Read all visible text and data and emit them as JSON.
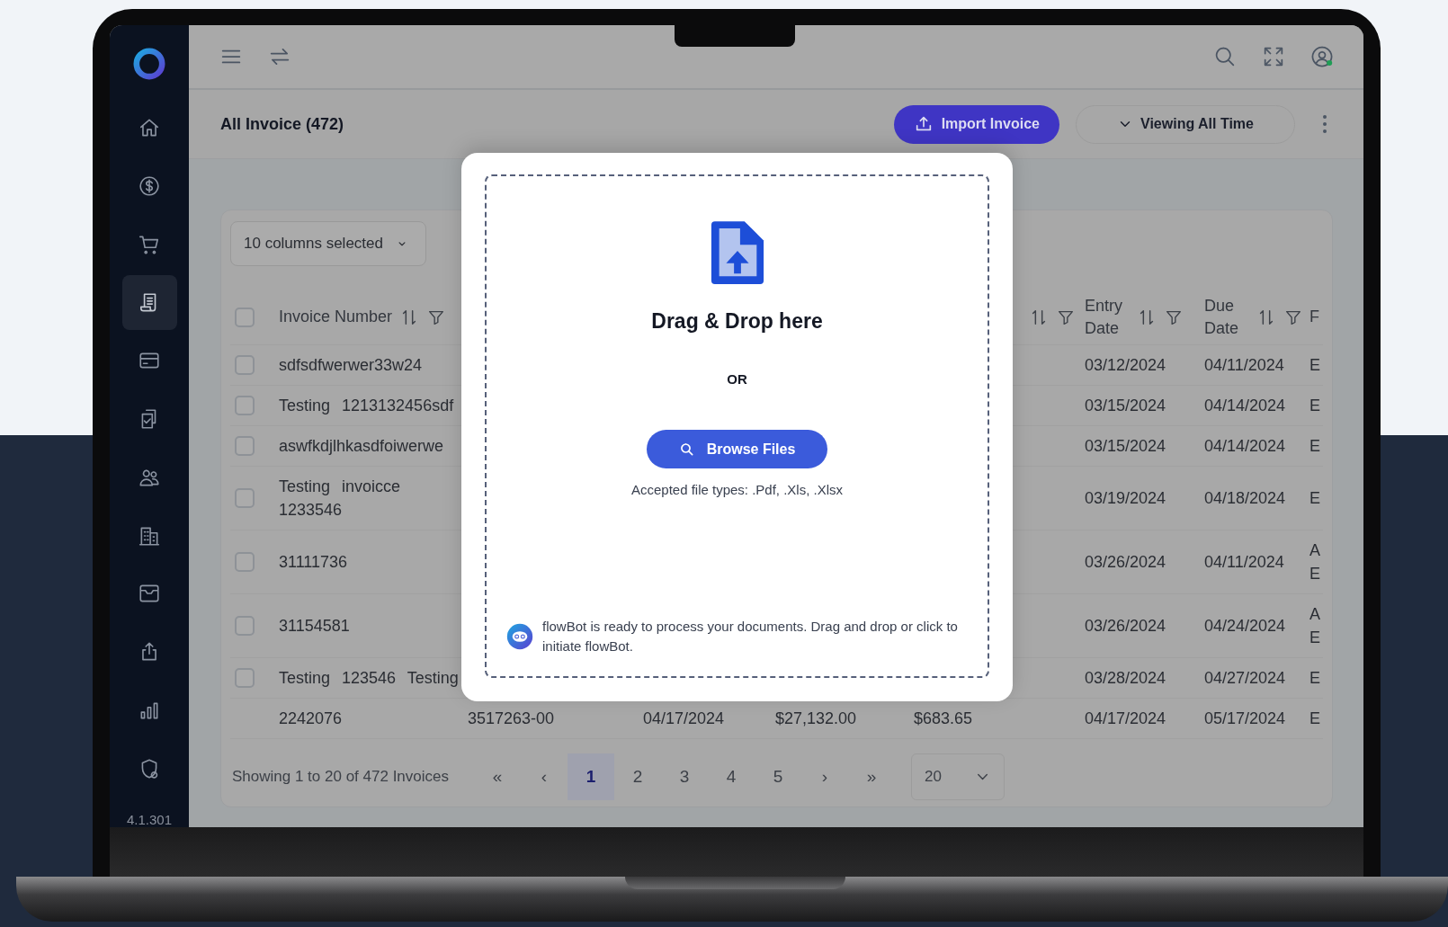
{
  "sidebar": {
    "items": [
      {
        "selected": false
      },
      {
        "selected": false
      },
      {
        "selected": false
      },
      {
        "selected": true
      },
      {
        "selected": false
      },
      {
        "selected": false
      },
      {
        "selected": false
      },
      {
        "selected": false
      },
      {
        "selected": false
      },
      {
        "selected": false
      },
      {
        "selected": false
      }
    ],
    "version": "4.1.301"
  },
  "header": {
    "title": "All Invoice (472)",
    "import_button": "Import Invoice",
    "period_button": "Viewing All Time"
  },
  "table": {
    "columns_selector": "10 columns selected",
    "select_all_checked": false,
    "columns": {
      "invoice_number": "Invoice Number",
      "entry_date": "Entry Date",
      "due_date": "Due Date",
      "column_8": "F"
    },
    "rows": [
      {
        "kind": "item",
        "checked": false,
        "invoice_number": "sdfsdfwerwer33w24",
        "entry_date": "03/12/2024",
        "due_date": "04/11/2024",
        "column_8": "E"
      },
      {
        "kind": "item",
        "checked": false,
        "invoice_number": "Testing 1213132456sdf",
        "entry_date": "03/15/2024",
        "due_date": "04/14/2024",
        "column_8": "E"
      },
      {
        "kind": "item",
        "checked": false,
        "invoice_number": "aswfkdjlhkasdfoiwerwe",
        "entry_date": "03/15/2024",
        "due_date": "04/14/2024",
        "column_8": "E"
      },
      {
        "kind": "item",
        "checked": false,
        "invoice_number": "Testing invoicce 1233546",
        "entry_date": "03/19/2024",
        "due_date": "04/18/2024",
        "column_8": "E"
      },
      {
        "kind": "item",
        "checked": false,
        "invoice_number": "31111736",
        "entry_date": "03/26/2024",
        "due_date": "04/11/2024",
        "column_8": "A E"
      },
      {
        "kind": "item",
        "checked": false,
        "invoice_number": "31154581",
        "entry_date": "03/26/2024",
        "due_date": "04/24/2024",
        "column_8": "A E"
      },
      {
        "kind": "item",
        "checked": false,
        "invoice_number": "Testing 123546 Testing",
        "entry_date": "03/28/2024",
        "due_date": "04/27/2024",
        "column_8": "E"
      },
      {
        "kind": "plain",
        "invoice_number": "2242076",
        "column_2": "3517263-00",
        "column_3": "04/17/2024",
        "column_4": "$27,132.00",
        "column_5": "$683.65",
        "entry_date": "04/17/2024",
        "due_date": "05/17/2024",
        "column_8": "E"
      }
    ]
  },
  "pagination": {
    "summary": "Showing 1 to 20 of 472 Invoices",
    "first": "«",
    "previous": "‹",
    "pages": [
      {
        "label": "1",
        "selected": true
      },
      {
        "label": "2",
        "selected": false
      },
      {
        "label": "3",
        "selected": false
      },
      {
        "label": "4",
        "selected": false
      },
      {
        "label": "5",
        "selected": false
      }
    ],
    "next": "›",
    "last": "»",
    "page_size": "20"
  },
  "upload_dialog": {
    "title": "Drag & Drop here",
    "separator": "OR",
    "browse_button": "Browse Files",
    "accepted_types": "Accepted file types: .Pdf, .Xls, .Xlsx",
    "bot_message": "flowBot is ready to process your documents. Drag and drop or click to initiate flowBot."
  }
}
